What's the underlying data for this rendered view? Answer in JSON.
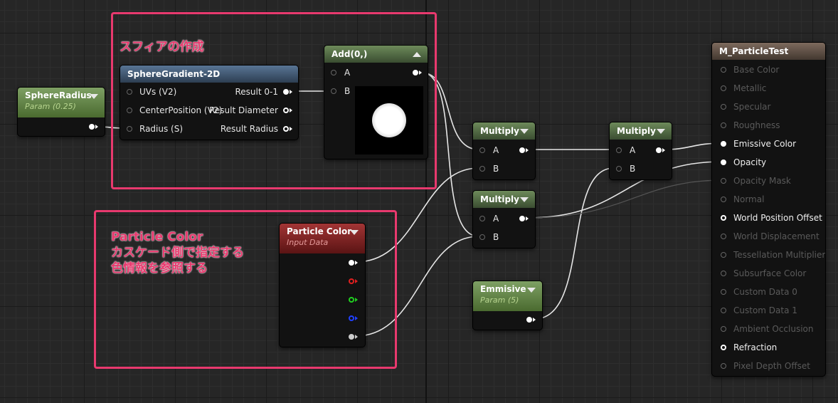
{
  "annotations": {
    "sphere_title": "スフィアの作成",
    "particle_line1": "Particle Color",
    "particle_line2": "カスケード側で指定する",
    "particle_line3": "色情報を参照する"
  },
  "nodes": {
    "sphere_radius": {
      "title": "SphereRadius",
      "subtitle": "Param (0.25)"
    },
    "sphere_gradient": {
      "title": "SphereGradient-2D",
      "inputs": [
        "UVs (V2)",
        "CenterPosition (V2)",
        "Radius (S)"
      ],
      "outputs": [
        "Result 0-1",
        "Result Diameter",
        "Result Radius"
      ]
    },
    "add": {
      "title": "Add(0,)",
      "inputs": [
        "A",
        "B"
      ]
    },
    "multiply1": {
      "title": "Multiply",
      "inputs": [
        "A",
        "B"
      ]
    },
    "multiply2": {
      "title": "Multiply",
      "inputs": [
        "A",
        "B"
      ]
    },
    "multiply3": {
      "title": "Multiply",
      "inputs": [
        "A",
        "B"
      ]
    },
    "particle_color": {
      "title": "Particle Color",
      "subtitle": "Input Data"
    },
    "emmisive": {
      "title": "Emmisive",
      "subtitle": "Param (5)"
    },
    "material": {
      "title": "M_ParticleTest",
      "pins": [
        {
          "label": "Base Color",
          "active": false
        },
        {
          "label": "Metallic",
          "active": false
        },
        {
          "label": "Specular",
          "active": false
        },
        {
          "label": "Roughness",
          "active": false
        },
        {
          "label": "Emissive Color",
          "active": true
        },
        {
          "label": "Opacity",
          "active": true
        },
        {
          "label": "Opacity Mask",
          "active": false
        },
        {
          "label": "Normal",
          "active": false
        },
        {
          "label": "World Position Offset",
          "active": true
        },
        {
          "label": "World Displacement",
          "active": false
        },
        {
          "label": "Tessellation Multiplier",
          "active": false
        },
        {
          "label": "Subsurface Color",
          "active": false
        },
        {
          "label": "Custom Data 0",
          "active": false
        },
        {
          "label": "Custom Data 1",
          "active": false
        },
        {
          "label": "Ambient Occlusion",
          "active": false
        },
        {
          "label": "Refraction",
          "active": true
        },
        {
          "label": "Pixel Depth Offset",
          "active": false
        }
      ]
    }
  },
  "colors": {
    "annotation": "#e8396e",
    "pin_red": "#e02020",
    "pin_green": "#20d020",
    "pin_blue": "#2040ff"
  }
}
